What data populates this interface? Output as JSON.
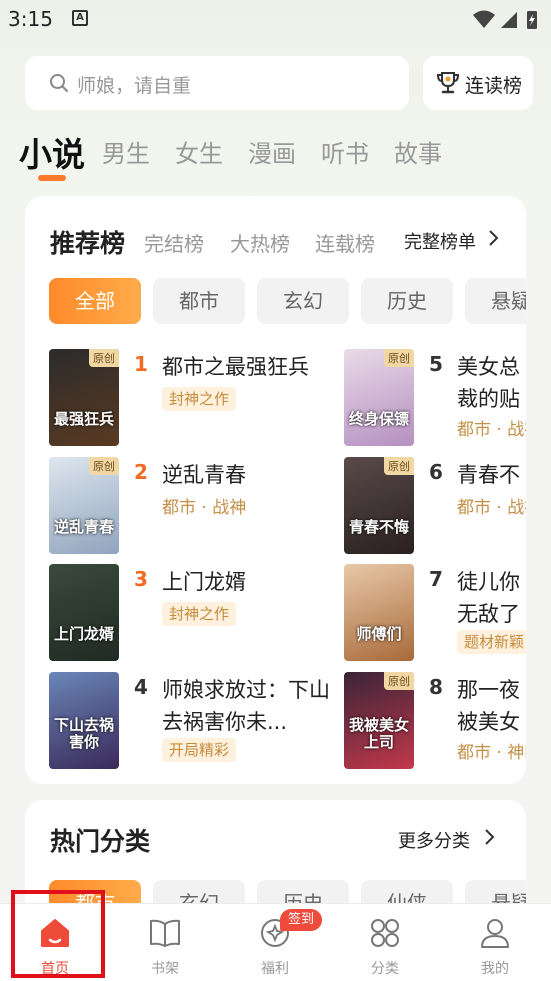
{
  "status": {
    "time": "3:15",
    "notification_icon": "A"
  },
  "search": {
    "placeholder": "师娘，请自重"
  },
  "rank_button": {
    "label": "连读榜"
  },
  "categories": [
    {
      "label": "小说",
      "active": true
    },
    {
      "label": "男生"
    },
    {
      "label": "女生"
    },
    {
      "label": "漫画"
    },
    {
      "label": "听书"
    },
    {
      "label": "故事"
    }
  ],
  "recommend": {
    "title": "推荐榜",
    "subtabs": [
      "完结榜",
      "大热榜",
      "连载榜"
    ],
    "full_list": "完整榜单",
    "filters": [
      "全部",
      "都市",
      "玄幻",
      "历史",
      "悬疑"
    ],
    "badge_text": "原创",
    "books": [
      {
        "rank": "1",
        "name": "都市之最强狂兵",
        "tag": "封神之作",
        "cover_text": "最强狂兵",
        "cover_colors": [
          "#2b2b2b",
          "#5a3a22"
        ]
      },
      {
        "rank": "2",
        "name": "逆乱青春",
        "meta": "都市 · 战神",
        "cover_text": "逆乱青春",
        "cover_colors": [
          "#dfe6ee",
          "#8fa4bd"
        ]
      },
      {
        "rank": "3",
        "name": "上门龙婿",
        "tag": "封神之作",
        "cover_text": "上门龙婿",
        "cover_colors": [
          "#3a4a3a",
          "#1f2a24"
        ]
      },
      {
        "rank": "4",
        "name": "师娘求放过：下山去祸害你未...",
        "tag": "开局精彩",
        "cover_text": "下山去祸害你",
        "cover_colors": [
          "#6a86b8",
          "#3a2a5a"
        ]
      },
      {
        "rank": "5",
        "name": "美女总裁的贴身保镖",
        "meta": "都市 · 战神",
        "cover_text": "终身保镖",
        "cover_colors": [
          "#e8dbe8",
          "#b58fc0"
        ]
      },
      {
        "rank": "6",
        "name": "青春不悔",
        "meta": "都市 · 战神",
        "cover_text": "青春不悔",
        "cover_colors": [
          "#5a4a4a",
          "#2a2020"
        ]
      },
      {
        "rank": "7",
        "name": "徒儿你无敌了快下山祸害你",
        "tag": "题材新颖",
        "cover_text": "师傅们",
        "cover_colors": [
          "#e8c8a8",
          "#a86a3a"
        ]
      },
      {
        "rank": "8",
        "name": "那一夜被美女上司",
        "meta": "都市 · 神医",
        "cover_text": "我被美女上司",
        "cover_colors": [
          "#3a2438",
          "#c2384a"
        ]
      }
    ]
  },
  "hot": {
    "title": "热门分类",
    "more": "更多分类",
    "chips": [
      "都市",
      "玄幻",
      "历史",
      "仙侠",
      "悬疑"
    ]
  },
  "tabbar": {
    "items": [
      {
        "label": "首页",
        "icon": "home-icon"
      },
      {
        "label": "书架",
        "icon": "book-icon"
      },
      {
        "label": "福利",
        "icon": "gift-icon"
      },
      {
        "label": "分类",
        "icon": "grid-icon"
      },
      {
        "label": "我的",
        "icon": "user-icon"
      }
    ],
    "welfare_badge": "签到"
  },
  "colors": {
    "accent": "#ff7a2e",
    "tab_active": "#ef4b3a",
    "highlight_box": "#e0101a"
  }
}
